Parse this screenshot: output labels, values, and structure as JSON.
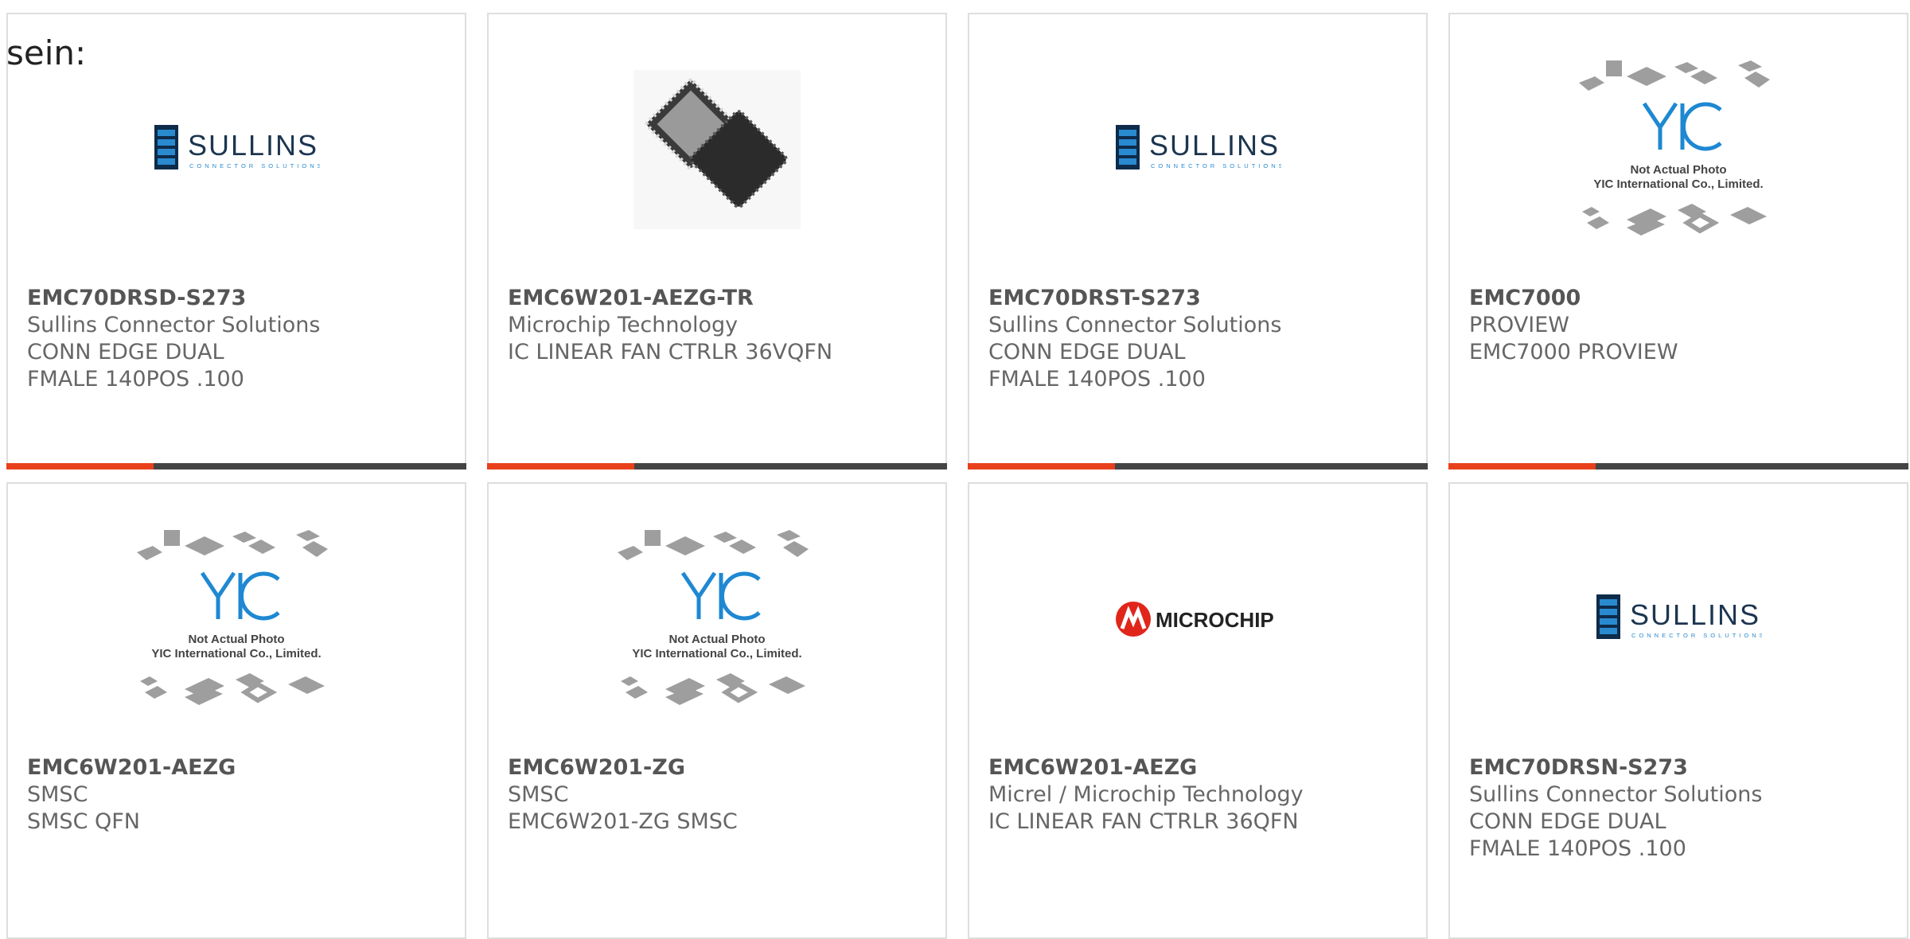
{
  "intro_text": "sein:",
  "colors": {
    "accent": "#e8401c",
    "bar": "#444444",
    "text": "#666666",
    "sullins_blue": "#1f7fc0",
    "microchip_red": "#e0261b"
  },
  "products": [
    {
      "part": "EMC70DRSD-S273",
      "manufacturer": "Sullins Connector Solutions",
      "description": "CONN EDGE DUAL FMALE 140POS .100",
      "image": "sullins-logo",
      "progress": 0.32
    },
    {
      "part": "EMC6W201-AEZG-TR",
      "manufacturer": "Microchip Technology",
      "description": "IC LINEAR FAN CTRLR 36VQFN",
      "image": "qfn-chip-photo",
      "progress": 0.32
    },
    {
      "part": "EMC70DRST-S273",
      "manufacturer": "Sullins Connector Solutions",
      "description": "CONN EDGE DUAL FMALE 140POS .100",
      "image": "sullins-logo",
      "progress": 0.32
    },
    {
      "part": "EMC7000",
      "manufacturer": "PROVIEW",
      "description": "EMC7000 PROVIEW",
      "image": "yic-placeholder",
      "progress": 0.32
    },
    {
      "part": "EMC6W201-AEZG",
      "manufacturer": "SMSC",
      "description": "SMSC QFN",
      "image": "yic-placeholder"
    },
    {
      "part": "EMC6W201-ZG",
      "manufacturer": "SMSC",
      "description": "EMC6W201-ZG SMSC",
      "image": "yic-placeholder"
    },
    {
      "part": "EMC6W201-AEZG",
      "manufacturer": "Micrel / Microchip Technology",
      "description": "IC LINEAR FAN CTRLR 36QFN",
      "image": "microchip-logo"
    },
    {
      "part": "EMC70DRSN-S273",
      "manufacturer": "Sullins Connector Solutions",
      "description": "CONN EDGE DUAL FMALE 140POS .100",
      "image": "sullins-logo"
    }
  ],
  "logos": {
    "sullins": {
      "name": "SULLINS",
      "tagline": "CONNECTOR SOLUTIONS"
    },
    "microchip": {
      "name": "MICROCHIP"
    },
    "yic": {
      "mark": "YIC",
      "line1": "Not Actual Photo",
      "line2": "YIC International Co., Limited."
    }
  }
}
